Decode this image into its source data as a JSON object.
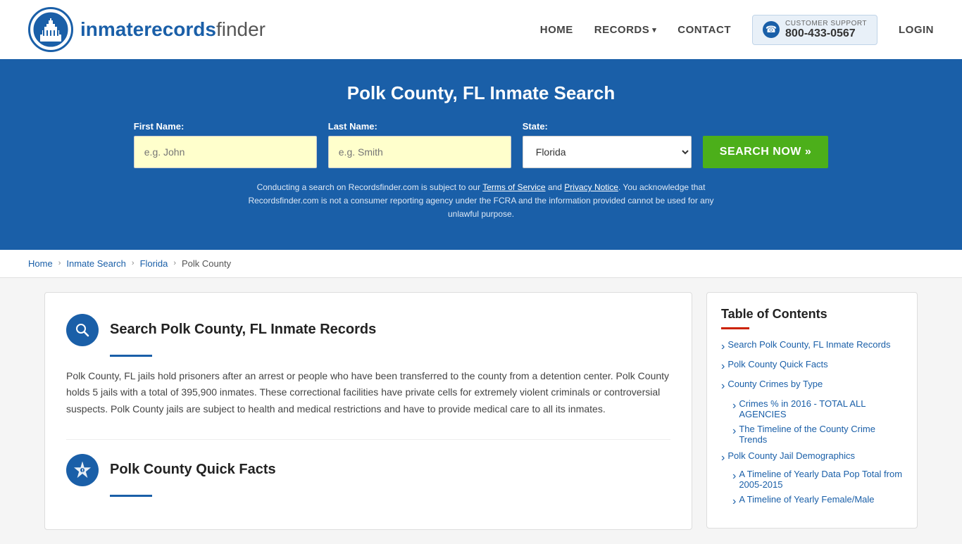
{
  "header": {
    "logo_text_regular": "inmaterecords",
    "logo_text_bold": "finder",
    "nav": {
      "home": "HOME",
      "records": "RECORDS",
      "contact": "CONTACT",
      "login": "LOGIN"
    },
    "support": {
      "label": "CUSTOMER SUPPORT",
      "number": "800-433-0567"
    }
  },
  "hero": {
    "title": "Polk County, FL Inmate Search",
    "first_name_label": "First Name:",
    "first_name_placeholder": "e.g. John",
    "last_name_label": "Last Name:",
    "last_name_placeholder": "e.g. Smith",
    "state_label": "State:",
    "state_value": "Florida",
    "search_button": "SEARCH NOW »",
    "disclaimer": "Conducting a search on Recordsfinder.com is subject to our Terms of Service and Privacy Notice. You acknowledge that Recordsfinder.com is not a consumer reporting agency under the FCRA and the information provided cannot be used for any unlawful purpose.",
    "tos_link": "Terms of Service",
    "privacy_link": "Privacy Notice"
  },
  "breadcrumb": {
    "home": "Home",
    "inmate_search": "Inmate Search",
    "florida": "Florida",
    "polk_county": "Polk County"
  },
  "main": {
    "section1": {
      "title": "Search Polk County, FL Inmate Records",
      "text": "Polk County, FL jails hold prisoners after an arrest or people who have been transferred to the county from a detention center. Polk County holds 5 jails with a total of 395,900 inmates. These correctional facilities have private cells for extremely violent criminals or controversial suspects. Polk County jails are subject to health and medical restrictions and have to provide medical care to all its inmates."
    },
    "section2": {
      "title": "Polk County Quick Facts"
    }
  },
  "toc": {
    "title": "Table of Contents",
    "items": [
      {
        "label": "Search Polk County, FL Inmate Records",
        "sub": []
      },
      {
        "label": "Polk County Quick Facts",
        "sub": []
      },
      {
        "label": "County Crimes by Type",
        "sub": []
      },
      {
        "label": "Crimes % in 2016 - TOTAL ALL AGENCIES",
        "sub": []
      },
      {
        "label": "The Timeline of the County Crime Trends",
        "sub": []
      },
      {
        "label": "Polk County Jail Demographics",
        "sub": []
      },
      {
        "label": "A Timeline of Yearly Data Pop Total from 2005-2015",
        "sub": []
      },
      {
        "label": "A Timeline of Yearly Female/Male",
        "sub": []
      }
    ]
  }
}
